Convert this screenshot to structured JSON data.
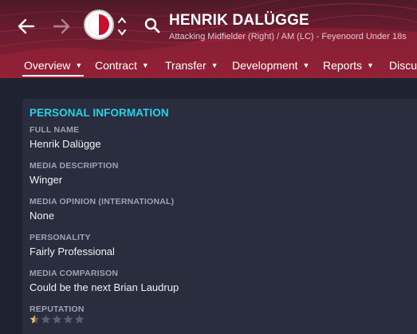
{
  "header": {
    "name": "HENRIK DALÜGGE",
    "subtitle": "Attacking Midfielder (Right) / AM (LC) - Feyenoord Under 18s",
    "icons": [
      "back-arrow-icon",
      "forward-arrow-icon",
      "club-badge",
      "chevron-up-down-icon",
      "search-icon"
    ]
  },
  "tabs": [
    {
      "label": "Overview",
      "active": true
    },
    {
      "label": "Contract"
    },
    {
      "label": "Transfer"
    },
    {
      "label": "Development"
    },
    {
      "label": "Reports"
    },
    {
      "label": "Discus"
    }
  ],
  "personal": {
    "title": "PERSONAL INFORMATION",
    "full_name_label": "FULL NAME",
    "full_name": "Henrik Dalügge",
    "media_description_label": "MEDIA DESCRIPTION",
    "media_description": "Winger",
    "media_opinion_label": "MEDIA OPINION (INTERNATIONAL)",
    "media_opinion": "None",
    "personality_label": "PERSONALITY",
    "personality": "Fairly Professional",
    "media_comparison_label": "MEDIA COMPARISON",
    "media_comparison": "Could be the next Brian Laudrup",
    "reputation_label": "REPUTATION",
    "reputation_stars": 0.5,
    "reputation_max": 5
  },
  "colors": {
    "accent": "#22d3ee",
    "header": "#8a1f33",
    "star_fill": "#f2c84b",
    "star_empty": "#5a5e70"
  }
}
